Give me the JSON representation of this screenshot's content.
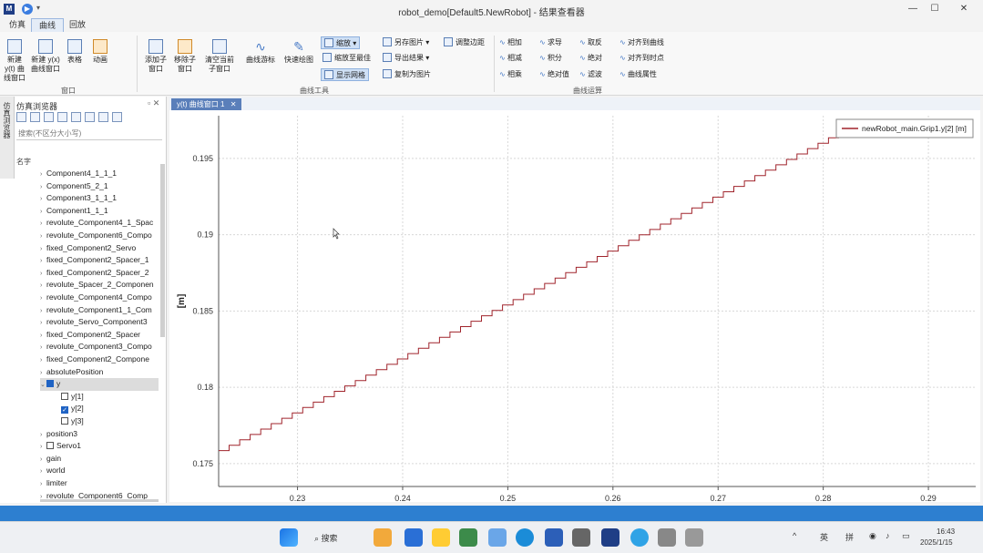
{
  "window": {
    "title": "robot_demo[Default5.NewRobot] - 结果查看器",
    "app_icon": "M",
    "minimize": "—",
    "maximize": "☐",
    "close": "✕"
  },
  "menu": [
    "仿真",
    "曲线",
    "回放"
  ],
  "ribbon": {
    "big_buttons": [
      {
        "label": "新建 y(t) 曲线窗口",
        "icon": "new-yt-plot-icon"
      },
      {
        "label": "新建 y(x) 曲线窗口",
        "icon": "new-yx-plot-icon"
      },
      {
        "label": "表格",
        "icon": "table-icon"
      },
      {
        "label": "动画",
        "icon": "animation-icon"
      },
      {
        "label": "添加子窗口",
        "icon": "add-subwindow-icon"
      },
      {
        "label": "移除子窗口",
        "icon": "remove-subwindow-icon"
      },
      {
        "label": "清空当前子窗口",
        "icon": "clear-subwindow-icon"
      },
      {
        "label": "曲线游标",
        "icon": "curve-cursor-icon"
      },
      {
        "label": "快速绘图",
        "icon": "quick-plot-icon"
      }
    ],
    "window_group_label": "窗口",
    "tools_small": {
      "zoom": "缩放",
      "zoom_max": "缩放至最佳",
      "show_grid": "显示网格",
      "export_img": "另存图片",
      "export_data": "导出结果",
      "copy_img": "复制为图片",
      "adjust_margin": "调整边距"
    },
    "tools_group_label": "曲线工具",
    "ops": [
      "相加",
      "求导",
      "取反",
      "对齐到曲线",
      "相减",
      "积分",
      "绝对",
      "对齐到时点",
      "相乘",
      "绝对值",
      "滤波",
      "曲线属性"
    ],
    "ops_group_label": "曲线运算"
  },
  "left_panel": {
    "vertical_tab": "仿真浏览器",
    "title": "仿真浏览器",
    "search_placeholder": "搜索(不区分大小写)",
    "column_header": "名字",
    "tree": [
      {
        "label": "Component4_1_1_1",
        "caret": "›",
        "check": null
      },
      {
        "label": "Component5_2_1",
        "caret": "›",
        "check": null
      },
      {
        "label": "Component3_1_1_1",
        "caret": "›",
        "check": null
      },
      {
        "label": "Component1_1_1",
        "caret": "›",
        "check": null
      },
      {
        "label": "revolute_Component4_1_Spac",
        "caret": "›",
        "check": null
      },
      {
        "label": "revolute_Component6_Compo",
        "caret": "›",
        "check": null
      },
      {
        "label": "fixed_Component2_Servo",
        "caret": "›",
        "check": null
      },
      {
        "label": "fixed_Component2_Spacer_1",
        "caret": "›",
        "check": null
      },
      {
        "label": "fixed_Component2_Spacer_2",
        "caret": "›",
        "check": null
      },
      {
        "label": "revolute_Spacer_2_Componen",
        "caret": "›",
        "check": null
      },
      {
        "label": "revolute_Component4_Compo",
        "caret": "›",
        "check": null
      },
      {
        "label": "revolute_Component1_1_Com",
        "caret": "›",
        "check": null
      },
      {
        "label": "revolute_Servo_Component3",
        "caret": "›",
        "check": null
      },
      {
        "label": "fixed_Component2_Spacer",
        "caret": "›",
        "check": null
      },
      {
        "label": "revolute_Component3_Compo",
        "caret": "›",
        "check": null
      },
      {
        "label": "fixed_Component2_Compone",
        "caret": "›",
        "check": null
      },
      {
        "label": "absolutePosition",
        "caret": "›",
        "check": null
      },
      {
        "label": "y",
        "caret": "⌄",
        "check": "partial"
      },
      {
        "label": "y[1]",
        "caret": "",
        "check": "off",
        "indent": 1
      },
      {
        "label": "y[2]",
        "caret": "",
        "check": "on",
        "indent": 1
      },
      {
        "label": "y[3]",
        "caret": "",
        "check": "off",
        "indent": 1
      },
      {
        "label": "position3",
        "caret": "›",
        "check": null
      },
      {
        "label": "Servo1",
        "caret": "›",
        "check": "off"
      },
      {
        "label": "gain",
        "caret": "›",
        "check": null
      },
      {
        "label": "world",
        "caret": "›",
        "check": null
      },
      {
        "label": "limiter",
        "caret": "›",
        "check": null
      },
      {
        "label": "revolute_Component6_Comp",
        "caret": "›",
        "check": null
      }
    ]
  },
  "plot_window": {
    "tab_label": "y(t) 曲线窗口 1",
    "tab_close": "✕",
    "legend": "newRobot_main.Grip1.y[2] [m]",
    "series_color": "#a0242c",
    "grid_color": "#d8d8d8",
    "ylabel_unit": "[m]"
  },
  "chart_data": {
    "type": "line",
    "ylabel": "[m]",
    "xlim": [
      0.2225,
      0.2945
    ],
    "ylim": [
      0.1735,
      0.1978
    ],
    "xticks": [
      0.23,
      0.24,
      0.25,
      0.26,
      0.27,
      0.28,
      0.29
    ],
    "yticks": [
      0.175,
      0.18,
      0.185,
      0.19,
      0.195
    ],
    "grid": true,
    "legend_position": "top-right",
    "series": [
      {
        "name": "newRobot_main.Grip1.y[2] [m]",
        "x_start": 0.2225,
        "x_step": 0.001,
        "x_end": 0.2805,
        "y_start": 0.17585,
        "y_end": 0.19635,
        "interpolation": "step"
      }
    ]
  },
  "taskbar": {
    "search": "搜索",
    "tray": [
      "英",
      "拼"
    ],
    "time": "16:43",
    "date": "2025/1/15"
  }
}
